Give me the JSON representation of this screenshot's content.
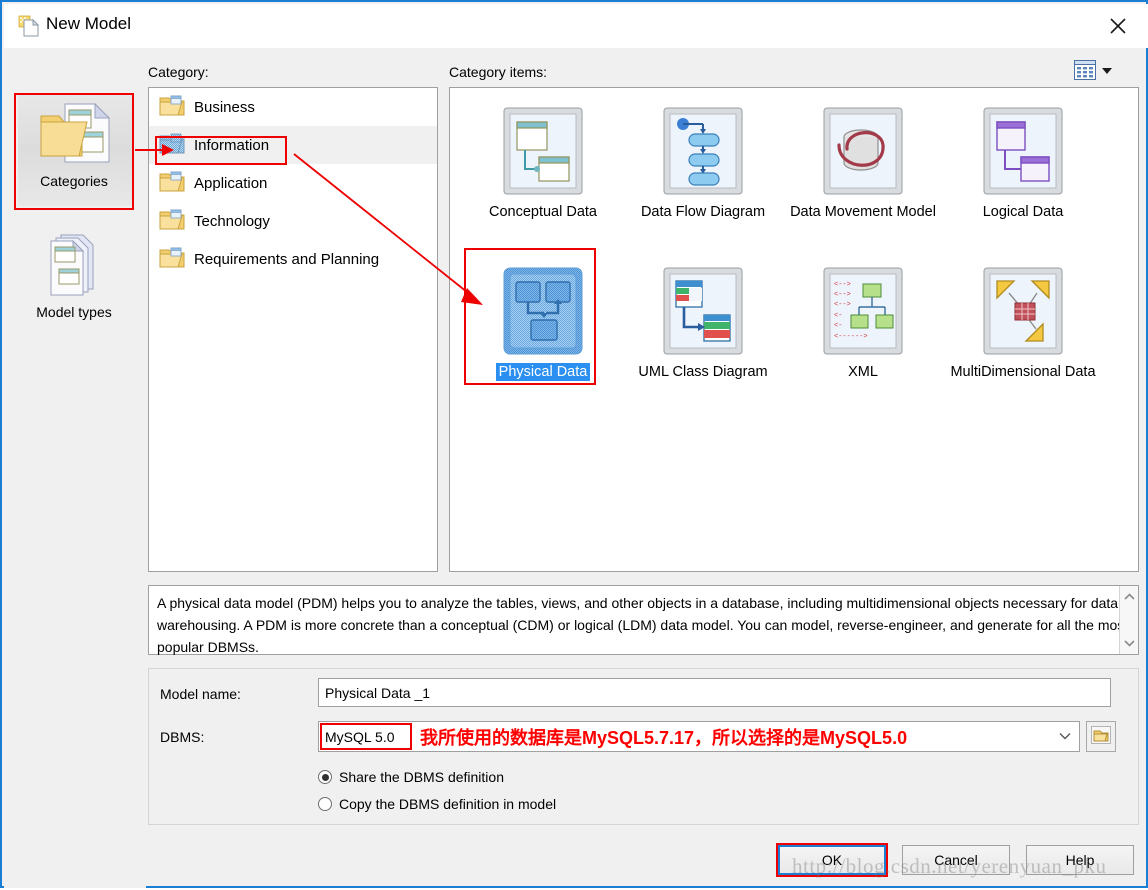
{
  "window": {
    "title": "New Model",
    "title_icon": "new-model-icon",
    "close_icon": "close-icon"
  },
  "sidebar": {
    "items": [
      {
        "label": "Categories",
        "icon": "categories-folder-icon",
        "selected": true
      },
      {
        "label": "Model types",
        "icon": "model-types-stack-icon",
        "selected": false
      }
    ]
  },
  "labels": {
    "category": "Category:",
    "category_items": "Category items:",
    "model_name": "Model name:",
    "dbms": "DBMS:"
  },
  "category_list": {
    "items": [
      {
        "label": "Business",
        "icon": "folder-icon",
        "selected": false
      },
      {
        "label": "Information",
        "icon": "folder-icon",
        "selected": true
      },
      {
        "label": "Application",
        "icon": "folder-icon",
        "selected": false
      },
      {
        "label": "Technology",
        "icon": "folder-icon",
        "selected": false
      },
      {
        "label": "Requirements and Planning",
        "icon": "folder-icon",
        "selected": false
      }
    ]
  },
  "view_toggle": {
    "icon": "grid-view-icon",
    "dropdown_icon": "chevron-down-icon"
  },
  "category_items": {
    "items": [
      {
        "label": "Conceptual Data",
        "icon": "conceptual-data-icon",
        "selected": false
      },
      {
        "label": "Data Flow Diagram",
        "icon": "data-flow-diagram-icon",
        "selected": false
      },
      {
        "label": "Data Movement Model",
        "icon": "data-movement-model-icon",
        "selected": false
      },
      {
        "label": "Logical Data",
        "icon": "logical-data-icon",
        "selected": false
      },
      {
        "label": "Physical Data",
        "icon": "physical-data-icon",
        "selected": true
      },
      {
        "label": "UML Class Diagram",
        "icon": "uml-class-diagram-icon",
        "selected": false
      },
      {
        "label": "XML",
        "icon": "xml-icon",
        "selected": false
      },
      {
        "label": "MultiDimensional Data",
        "icon": "multidimensional-data-icon",
        "selected": false
      }
    ]
  },
  "description": {
    "text": "A physical data model (PDM) helps you to analyze the tables, views, and other objects in a database, including multidimensional objects necessary for data warehousing. A PDM is more concrete than a conceptual (CDM) or logical (LDM) data model. You can model, reverse-engineer, and generate for all the most popular DBMSs.",
    "scroll_up_icon": "chevron-up-icon",
    "scroll_down_icon": "chevron-down-icon"
  },
  "form": {
    "model_name_value": "Physical Data _1",
    "model_name_placeholder": "",
    "dbms_value": "MySQL 5.0",
    "dbms_dropdown_icon": "chevron-down-icon",
    "dbms_folder_icon": "folder-icon",
    "radios": [
      {
        "label": "Share the DBMS definition",
        "selected": true
      },
      {
        "label": "Copy the DBMS definition in model",
        "selected": false
      }
    ]
  },
  "footer": {
    "ok": "OK",
    "cancel": "Cancel",
    "help": "Help"
  },
  "annotations": {
    "dbms_note": "我所使用的数据库是MySQL5.7.17，所以选择的是MySQL5.0",
    "highlight_color": "#ee0000",
    "note_color": "#ff0000"
  },
  "watermark": {
    "text": "http://blog.csdn.net/yerenyuan_pku"
  }
}
